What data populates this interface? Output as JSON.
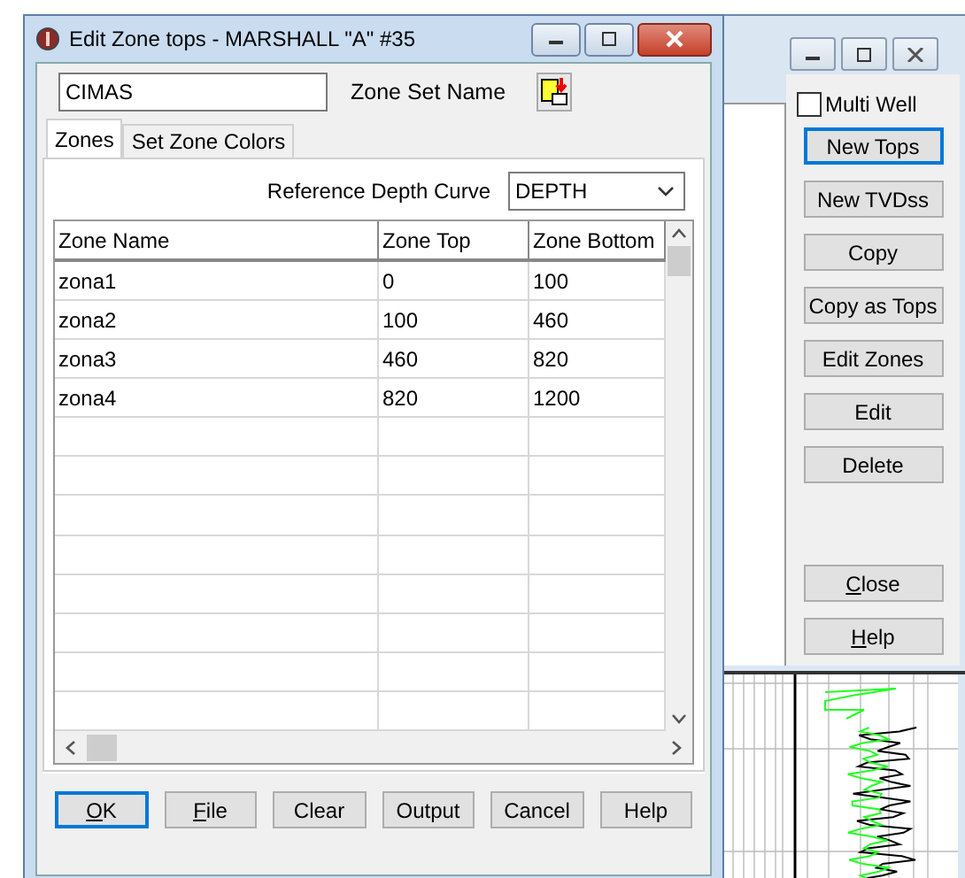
{
  "dialog": {
    "title": "Edit Zone tops - MARSHALL \"A\" #35",
    "zone_set_name": {
      "value": "CIMAS",
      "label": "Zone Set Name"
    },
    "tabs": [
      {
        "label": "Zones",
        "selected": true
      },
      {
        "label": "Set Zone Colors",
        "selected": false
      }
    ],
    "reference_depth_curve": {
      "label": "Reference Depth Curve",
      "value": "DEPTH"
    },
    "table": {
      "columns": [
        "Zone Name",
        "Zone Top",
        "Zone Bottom"
      ],
      "rows": [
        [
          "zona1",
          "0",
          "100"
        ],
        [
          "zona2",
          "100",
          "460"
        ],
        [
          "zona3",
          "460",
          "820"
        ],
        [
          "zona4",
          "820",
          "1200"
        ]
      ]
    },
    "buttons": [
      {
        "label": "OK",
        "mnemonic": true,
        "focused": true
      },
      {
        "label": "File",
        "mnemonic": true,
        "focused": false
      },
      {
        "label": "Clear",
        "focused": false
      },
      {
        "label": "Output",
        "focused": false
      },
      {
        "label": "Cancel",
        "focused": false
      },
      {
        "label": "Help",
        "focused": false
      }
    ]
  },
  "side_panel": {
    "multi_well": {
      "label": "Multi Well",
      "checked": false
    },
    "buttons": [
      {
        "label": "New Tops",
        "focused": true
      },
      {
        "label": "New TVDss",
        "focused": false
      },
      {
        "label": "Copy",
        "focused": false
      },
      {
        "label": "Copy as Tops",
        "focused": false
      },
      {
        "label": "Edit Zones",
        "focused": false
      },
      {
        "label": "Edit",
        "focused": false
      },
      {
        "label": "Delete",
        "focused": false
      }
    ],
    "bottom_buttons": [
      {
        "label": "Close",
        "mnemonic": true,
        "focused": false
      },
      {
        "label": "Help",
        "mnemonic": true,
        "focused": false
      }
    ]
  }
}
